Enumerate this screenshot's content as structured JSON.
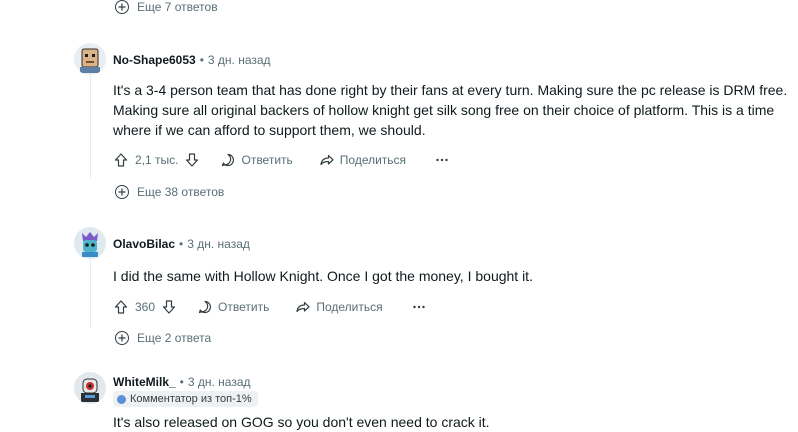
{
  "top_thread": {
    "more_replies": "Еще 7 ответов"
  },
  "comments": [
    {
      "username": "No-Shape6053",
      "time": "3 дн. назад",
      "text_lines": [
        "It's a 3-4 person team that has done right by their fans at every turn. Making sure the pc release is DRM free.",
        "Making sure all original backers of hollow knight get silk song free on their choice of platform. This is a time",
        "where if we can afford to support them, we should."
      ],
      "votes": "2,1 тыс.",
      "reply_label": "Ответить",
      "share_label": "Поделиться",
      "more_replies": "Еще 38 ответов"
    },
    {
      "username": "OlavoBilac",
      "time": "3 дн. назад",
      "text_lines": [
        "I did the same with Hollow Knight. Once I got the money, I bought it."
      ],
      "votes": "360",
      "reply_label": "Ответить",
      "share_label": "Поделиться",
      "more_replies": "Еще 2 ответа"
    },
    {
      "username": "WhiteMilk_",
      "time": "3 дн. назад",
      "badge": "Комментатор из топ-1%",
      "text_lines": [
        "It's also released on GOG so you don't even need to crack it."
      ]
    }
  ],
  "separator": "•",
  "icons": [
    "plus-icon",
    "upvote-icon",
    "downvote-icon",
    "comment-icon",
    "share-icon",
    "more-icon"
  ],
  "colors": {
    "muted": "#576f76",
    "text": "#0f1a1c",
    "line": "#e5ebee"
  }
}
